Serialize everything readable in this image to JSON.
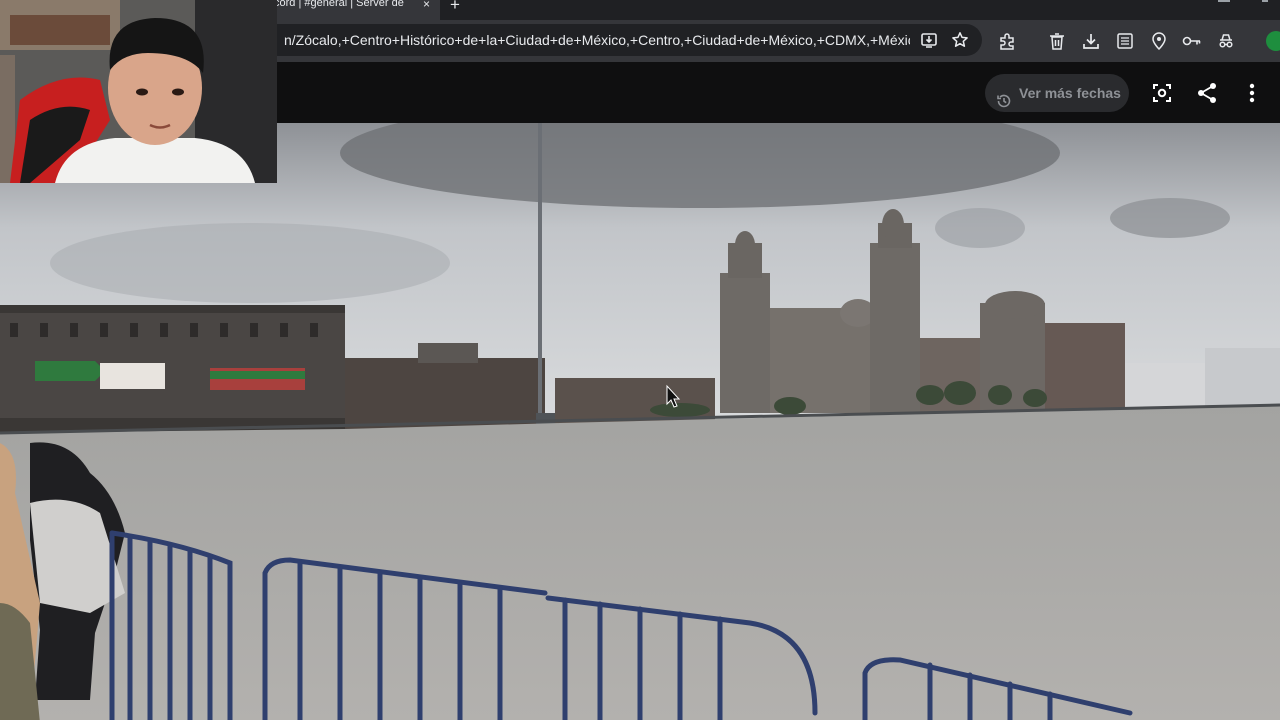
{
  "browser": {
    "tab_title": "cord | #general | Server de",
    "tab_close_glyph": "×",
    "new_tab_glyph": "+",
    "address": "n/Zócalo,+Centro+Histórico+de+la+Ciudad+de+México,+Centro,+Ciudad+de+México,+CDMX,+México/@...",
    "toolbar_icons": [
      "install-icon",
      "star-icon",
      "extensions-icon",
      "trash-icon",
      "download-icon",
      "reader-icon",
      "location-icon",
      "key-icon",
      "incognito-icon",
      "profile-avatar"
    ]
  },
  "streetview": {
    "more_dates_label": "Ver más fechas",
    "header_icons": [
      "screenshot-icon",
      "share-icon",
      "more-vert-icon"
    ]
  },
  "scene": {
    "description_icons": [
      "webcam-overlay",
      "panorama"
    ]
  },
  "colors": {
    "chrome_dark": "#1f2023",
    "toolbar": "#35363a",
    "omnibox": "#202124",
    "header_bg": "#0f0f10",
    "sky": "#c9ccd0",
    "plaza": "#a9a8a6",
    "fence": "#2f3f6e"
  }
}
